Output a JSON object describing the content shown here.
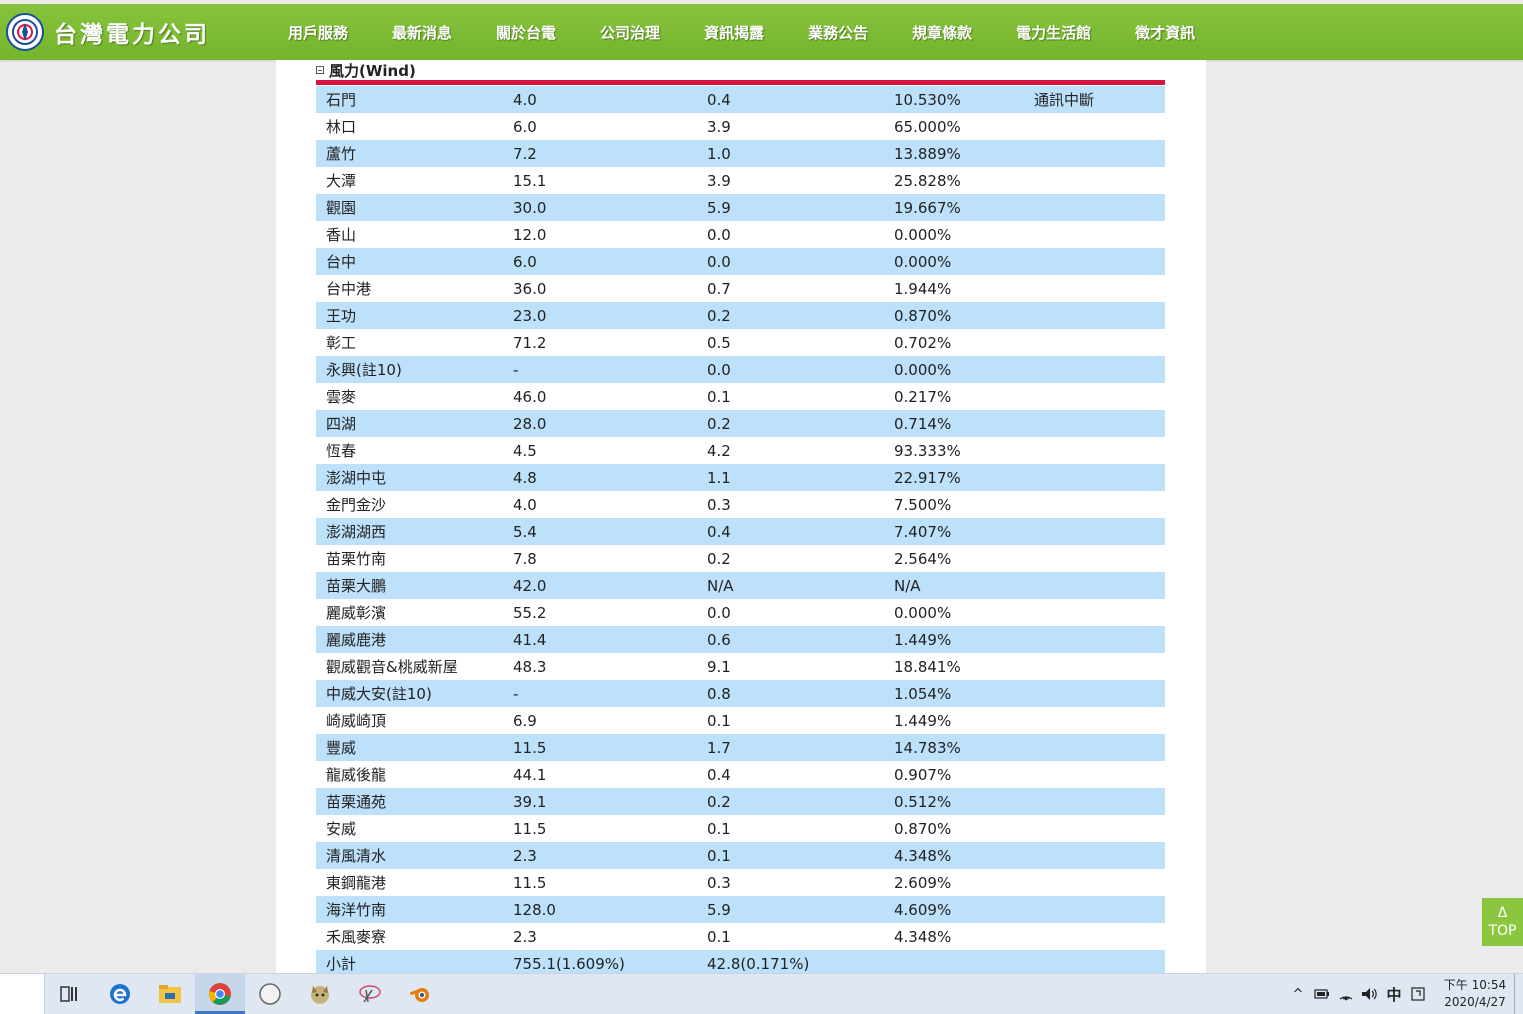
{
  "header": {
    "logo_text": "台灣電力公司",
    "nav": [
      {
        "label": "用戶服務",
        "name": "nav-customer-service"
      },
      {
        "label": "最新消息",
        "name": "nav-news"
      },
      {
        "label": "關於台電",
        "name": "nav-about"
      },
      {
        "label": "公司治理",
        "name": "nav-governance"
      },
      {
        "label": "資訊揭露",
        "name": "nav-disclosure"
      },
      {
        "label": "業務公告",
        "name": "nav-announcements"
      },
      {
        "label": "規章條款",
        "name": "nav-regulations"
      },
      {
        "label": "電力生活館",
        "name": "nav-power-life"
      },
      {
        "label": "徵才資訊",
        "name": "nav-recruitment"
      }
    ],
    "active_nav": "資訊揭露"
  },
  "section": {
    "title": "風力(Wind)"
  },
  "wind_table": {
    "rows": [
      [
        "石門",
        "4.0",
        "0.4",
        "10.530%",
        "通訊中斷"
      ],
      [
        "林口",
        "6.0",
        "3.9",
        "65.000%",
        ""
      ],
      [
        "蘆竹",
        "7.2",
        "1.0",
        "13.889%",
        ""
      ],
      [
        "大潭",
        "15.1",
        "3.9",
        "25.828%",
        ""
      ],
      [
        "觀園",
        "30.0",
        "5.9",
        "19.667%",
        ""
      ],
      [
        "香山",
        "12.0",
        "0.0",
        "0.000%",
        ""
      ],
      [
        "台中",
        "6.0",
        "0.0",
        "0.000%",
        ""
      ],
      [
        "台中港",
        "36.0",
        "0.7",
        "1.944%",
        ""
      ],
      [
        "王功",
        "23.0",
        "0.2",
        "0.870%",
        ""
      ],
      [
        "彰工",
        "71.2",
        "0.5",
        "0.702%",
        ""
      ],
      [
        "永興(註10)",
        "-",
        "0.0",
        "0.000%",
        ""
      ],
      [
        "雲麥",
        "46.0",
        "0.1",
        "0.217%",
        ""
      ],
      [
        "四湖",
        "28.0",
        "0.2",
        "0.714%",
        ""
      ],
      [
        "恆春",
        "4.5",
        "4.2",
        "93.333%",
        ""
      ],
      [
        "澎湖中屯",
        "4.8",
        "1.1",
        "22.917%",
        ""
      ],
      [
        "金門金沙",
        "4.0",
        "0.3",
        "7.500%",
        ""
      ],
      [
        "澎湖湖西",
        "5.4",
        "0.4",
        "7.407%",
        ""
      ],
      [
        "苗栗竹南",
        "7.8",
        "0.2",
        "2.564%",
        ""
      ],
      [
        "苗栗大鵬",
        "42.0",
        "N/A",
        "N/A",
        ""
      ],
      [
        "麗威彰濱",
        "55.2",
        "0.0",
        "0.000%",
        ""
      ],
      [
        "麗威鹿港",
        "41.4",
        "0.6",
        "1.449%",
        ""
      ],
      [
        "觀威觀音&桃威新屋",
        "48.3",
        "9.1",
        "18.841%",
        ""
      ],
      [
        "中威大安(註10)",
        "-",
        "0.8",
        "1.054%",
        ""
      ],
      [
        "崎威崎頂",
        "6.9",
        "0.1",
        "1.449%",
        ""
      ],
      [
        "豐威",
        "11.5",
        "1.7",
        "14.783%",
        ""
      ],
      [
        "龍威後龍",
        "44.1",
        "0.4",
        "0.907%",
        ""
      ],
      [
        "苗栗通苑",
        "39.1",
        "0.2",
        "0.512%",
        ""
      ],
      [
        "安威",
        "11.5",
        "0.1",
        "0.870%",
        ""
      ],
      [
        "清風清水",
        "2.3",
        "0.1",
        "4.348%",
        ""
      ],
      [
        "東鋼龍港",
        "11.5",
        "0.3",
        "2.609%",
        ""
      ],
      [
        "海洋竹南",
        "128.0",
        "5.9",
        "4.609%",
        ""
      ],
      [
        "禾風麥寮",
        "2.3",
        "0.1",
        "4.348%",
        ""
      ],
      [
        "小計",
        "755.1(1.609%)",
        "42.8(0.171%)",
        "",
        ""
      ]
    ]
  },
  "top_button": {
    "arrow": "Δ",
    "label": "TOP"
  },
  "taskbar": {
    "apps": [
      {
        "icon": "task-view-icon",
        "glyph": "⧉"
      },
      {
        "icon": "edge-icon",
        "glyph": "e"
      },
      {
        "icon": "file-explorer-icon",
        "glyph": "▬"
      },
      {
        "icon": "chrome-icon",
        "glyph": "●"
      },
      {
        "icon": "compass-icon",
        "glyph": "◎"
      },
      {
        "icon": "fox-app-icon",
        "glyph": "✦"
      },
      {
        "icon": "scissors-app-icon",
        "glyph": "✂"
      },
      {
        "icon": "blender-icon",
        "glyph": "◉"
      }
    ],
    "tray": {
      "chevron": "^",
      "ime": "中",
      "time": "下午 10:54",
      "date": "2020/4/27"
    }
  },
  "colors": {
    "nav_green": "#7ab92f",
    "row_blue": "#bde0fb",
    "accent_red": "#d6153e",
    "top_button_green": "#8cc63f"
  }
}
